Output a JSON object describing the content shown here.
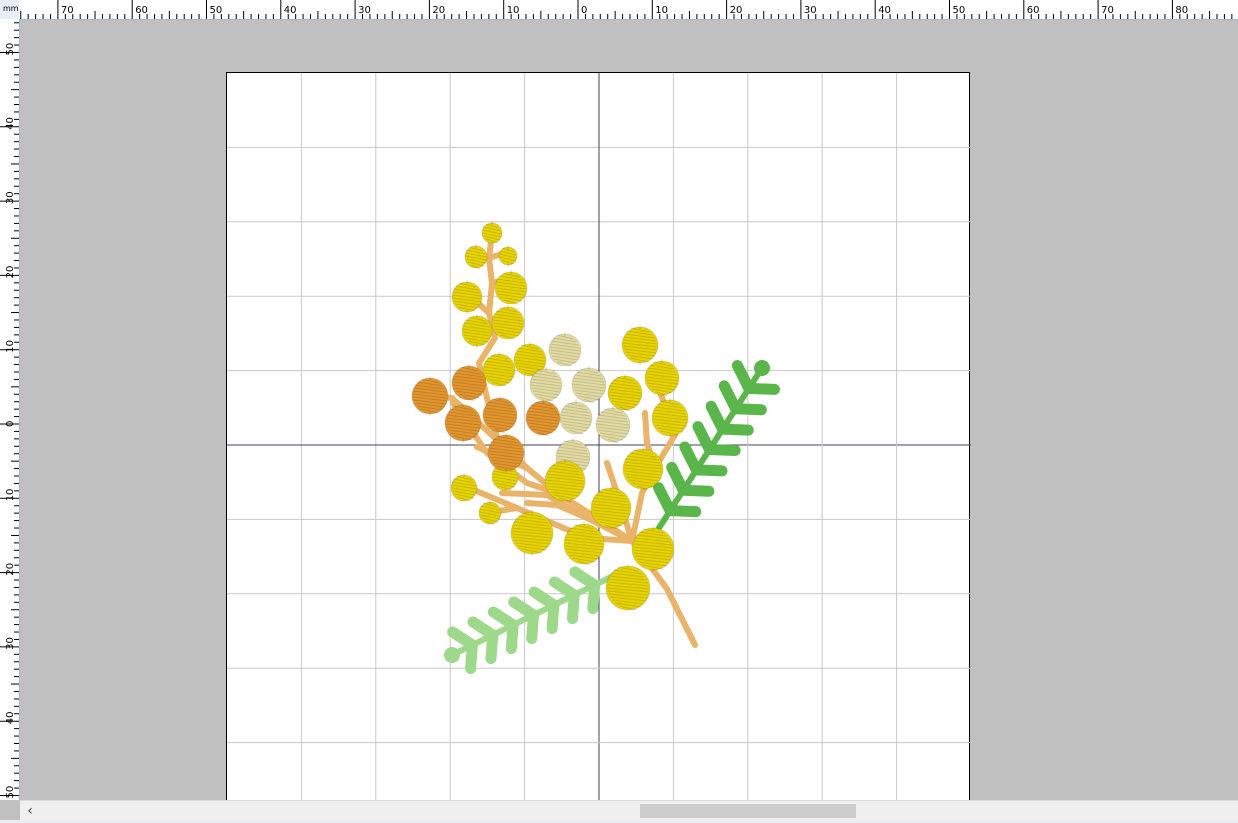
{
  "app": {
    "view": "embroidery design preview"
  },
  "ruler": {
    "unit": "mm",
    "top_labels": [
      "70",
      "60",
      "50",
      "40",
      "30",
      "20",
      "10",
      "0",
      "10",
      "20",
      "30",
      "40",
      "50",
      "60",
      "70",
      "80"
    ],
    "left_labels": [
      "50",
      "40",
      "30",
      "20",
      "10",
      "0",
      "10",
      "20",
      "30",
      "40",
      "50"
    ]
  },
  "colors": {
    "workspace_bg": "#c0c0c0",
    "hoop_bg": "#ffffff",
    "grid_line": "#c8c8c8",
    "axis_line": "#404060",
    "ruler_bg": "#ffffff",
    "ruler_border": "#a0b8d8",
    "thread_yellow": "#e8d400",
    "thread_pale_yellow": "#e2dca2",
    "thread_orange": "#e3962e",
    "thread_tan_stem": "#e9b46a",
    "thread_green": "#5ab64a",
    "thread_light_green": "#9ed88a"
  },
  "scrollbar": {
    "left_arrow_icon": "‹"
  }
}
